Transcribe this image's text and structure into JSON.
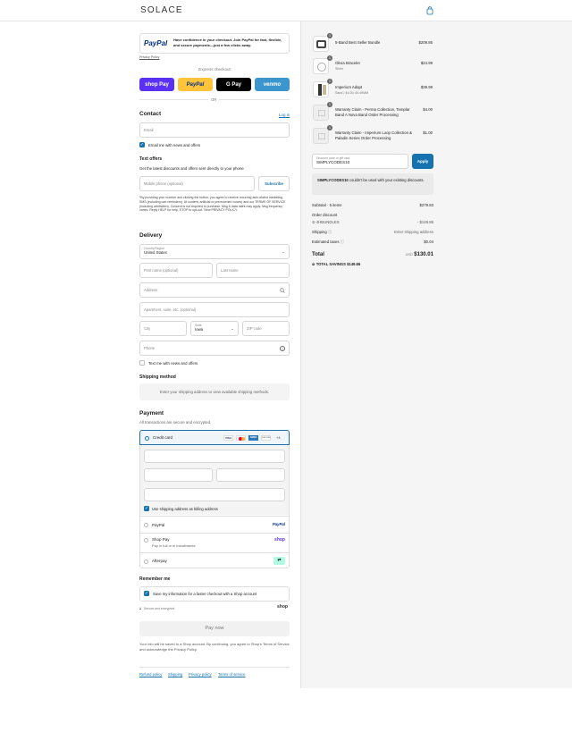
{
  "brand": "SOLACE",
  "paypal_banner": {
    "logo": "PayPal",
    "text": "Have confidence in your checkout. Join PayPal for fast, flexible, and secure payments—just a few clicks away.",
    "privacy": "Privacy Policy"
  },
  "express": {
    "label": "Express checkout",
    "buttons": [
      "shop Pay",
      "PayPal",
      "G Pay",
      "venmo"
    ],
    "or": "OR"
  },
  "contact": {
    "title": "Contact",
    "login": "Log in",
    "email_placeholder": "Email",
    "email_news": "Email me with news and offers"
  },
  "text_offers": {
    "title": "Text offers",
    "desc": "Get the latest discounts and offers sent directly to your phone",
    "phone_placeholder": "Mobile phone (optional)",
    "subscribe": "Subscribe",
    "legal": "*By providing your number and clicking the button, you agree to receive recurring auto-dialed marketing SMS (including cart reminders). At content, artificial or prerecorded voices) and our TERMS OF SERVICE (including arbitration). Consent is not required to purchase. Msg & data rates may apply. Msg frequency varies. Reply HELP for help, STOP to opt-out. View PRIVACY POLICY."
  },
  "delivery": {
    "title": "Delivery",
    "country_label": "Country/Region",
    "country": "United States",
    "first_name": "First name (optional)",
    "last_name": "Last name",
    "address": "Address",
    "apartment": "Apartment, suite, etc. (optional)",
    "city": "City",
    "state_label": "State",
    "state": "Iowa",
    "zip": "ZIP code",
    "phone": "Phone",
    "text_news": "Text me with news and offers"
  },
  "shipping": {
    "title": "Shipping method",
    "message": "Enter your shipping address to view available shipping methods."
  },
  "payment": {
    "title": "Payment",
    "subtitle": "All transactions are secure and encrypted.",
    "credit_card": "Credit card",
    "card_brands": [
      "VISA",
      "MC",
      "AMEX",
      "DISCOVER",
      "+4"
    ],
    "use_shipping": "Use shipping address as billing address",
    "paypal": "PayPal",
    "shop_pay": "Shop Pay",
    "shop_pay_sub": "Pay in full or in installments",
    "afterpay": "Afterpay"
  },
  "remember": {
    "title": "Remember me",
    "save_info": "Save my information for a faster checkout with a Shop account",
    "secure": "Secure and encrypted",
    "shop": "shop"
  },
  "pay_now": "Pay now",
  "footer_note": "Your info will be saved to a Shop account. By continuing, you agree to Shop's Terms of Service and acknowledge the Privacy Policy.",
  "footer_links": [
    "Refund policy",
    "Shipping",
    "Privacy policy",
    "Terms of service"
  ],
  "cart": {
    "items": [
      {
        "qty": "1",
        "name": "5-Band Best Seller Bundle",
        "sub": "",
        "price": "$209.85"
      },
      {
        "qty": "1",
        "name": "Olivia Bracelet",
        "sub": "Silver",
        "price": "$24.99"
      },
      {
        "qty": "1",
        "name": "Imperium Adapt",
        "sub": "Sand / 44.0D 40-49MM",
        "price": "$39.99"
      },
      {
        "qty": "1",
        "name": "Warranty Claim - Perma Collection, Templar Band A Nova Band Order Processing",
        "sub": "",
        "price": "$4.00"
      },
      {
        "qty": "1",
        "name": "Warranty Claim - Imperium Loop Collection & Paladin Series Order Processing",
        "sub": "",
        "price": "$1.00"
      }
    ],
    "discount_label": "Discount code or gift card",
    "discount_value": "SIMPLYCODES10",
    "apply": "Apply",
    "discount_error_code": "SIMPLYCODES10",
    "discount_error": " couldn't be used with your existing discounts.",
    "subtotal_label": "Subtotal · 5 items",
    "subtotal": "$279.83",
    "order_discount": "Order discount",
    "discount_code": "4HBUNDLES",
    "discount_amount": "- $149.86",
    "shipping_label": "Shipping",
    "shipping_value": "Enter shipping address",
    "taxes_label": "Estimated taxes",
    "taxes": "$0.04",
    "total_label": "Total",
    "currency": "USD",
    "total": "$130.01",
    "savings_label": "TOTAL SAVINGS",
    "savings": "$149.86"
  }
}
